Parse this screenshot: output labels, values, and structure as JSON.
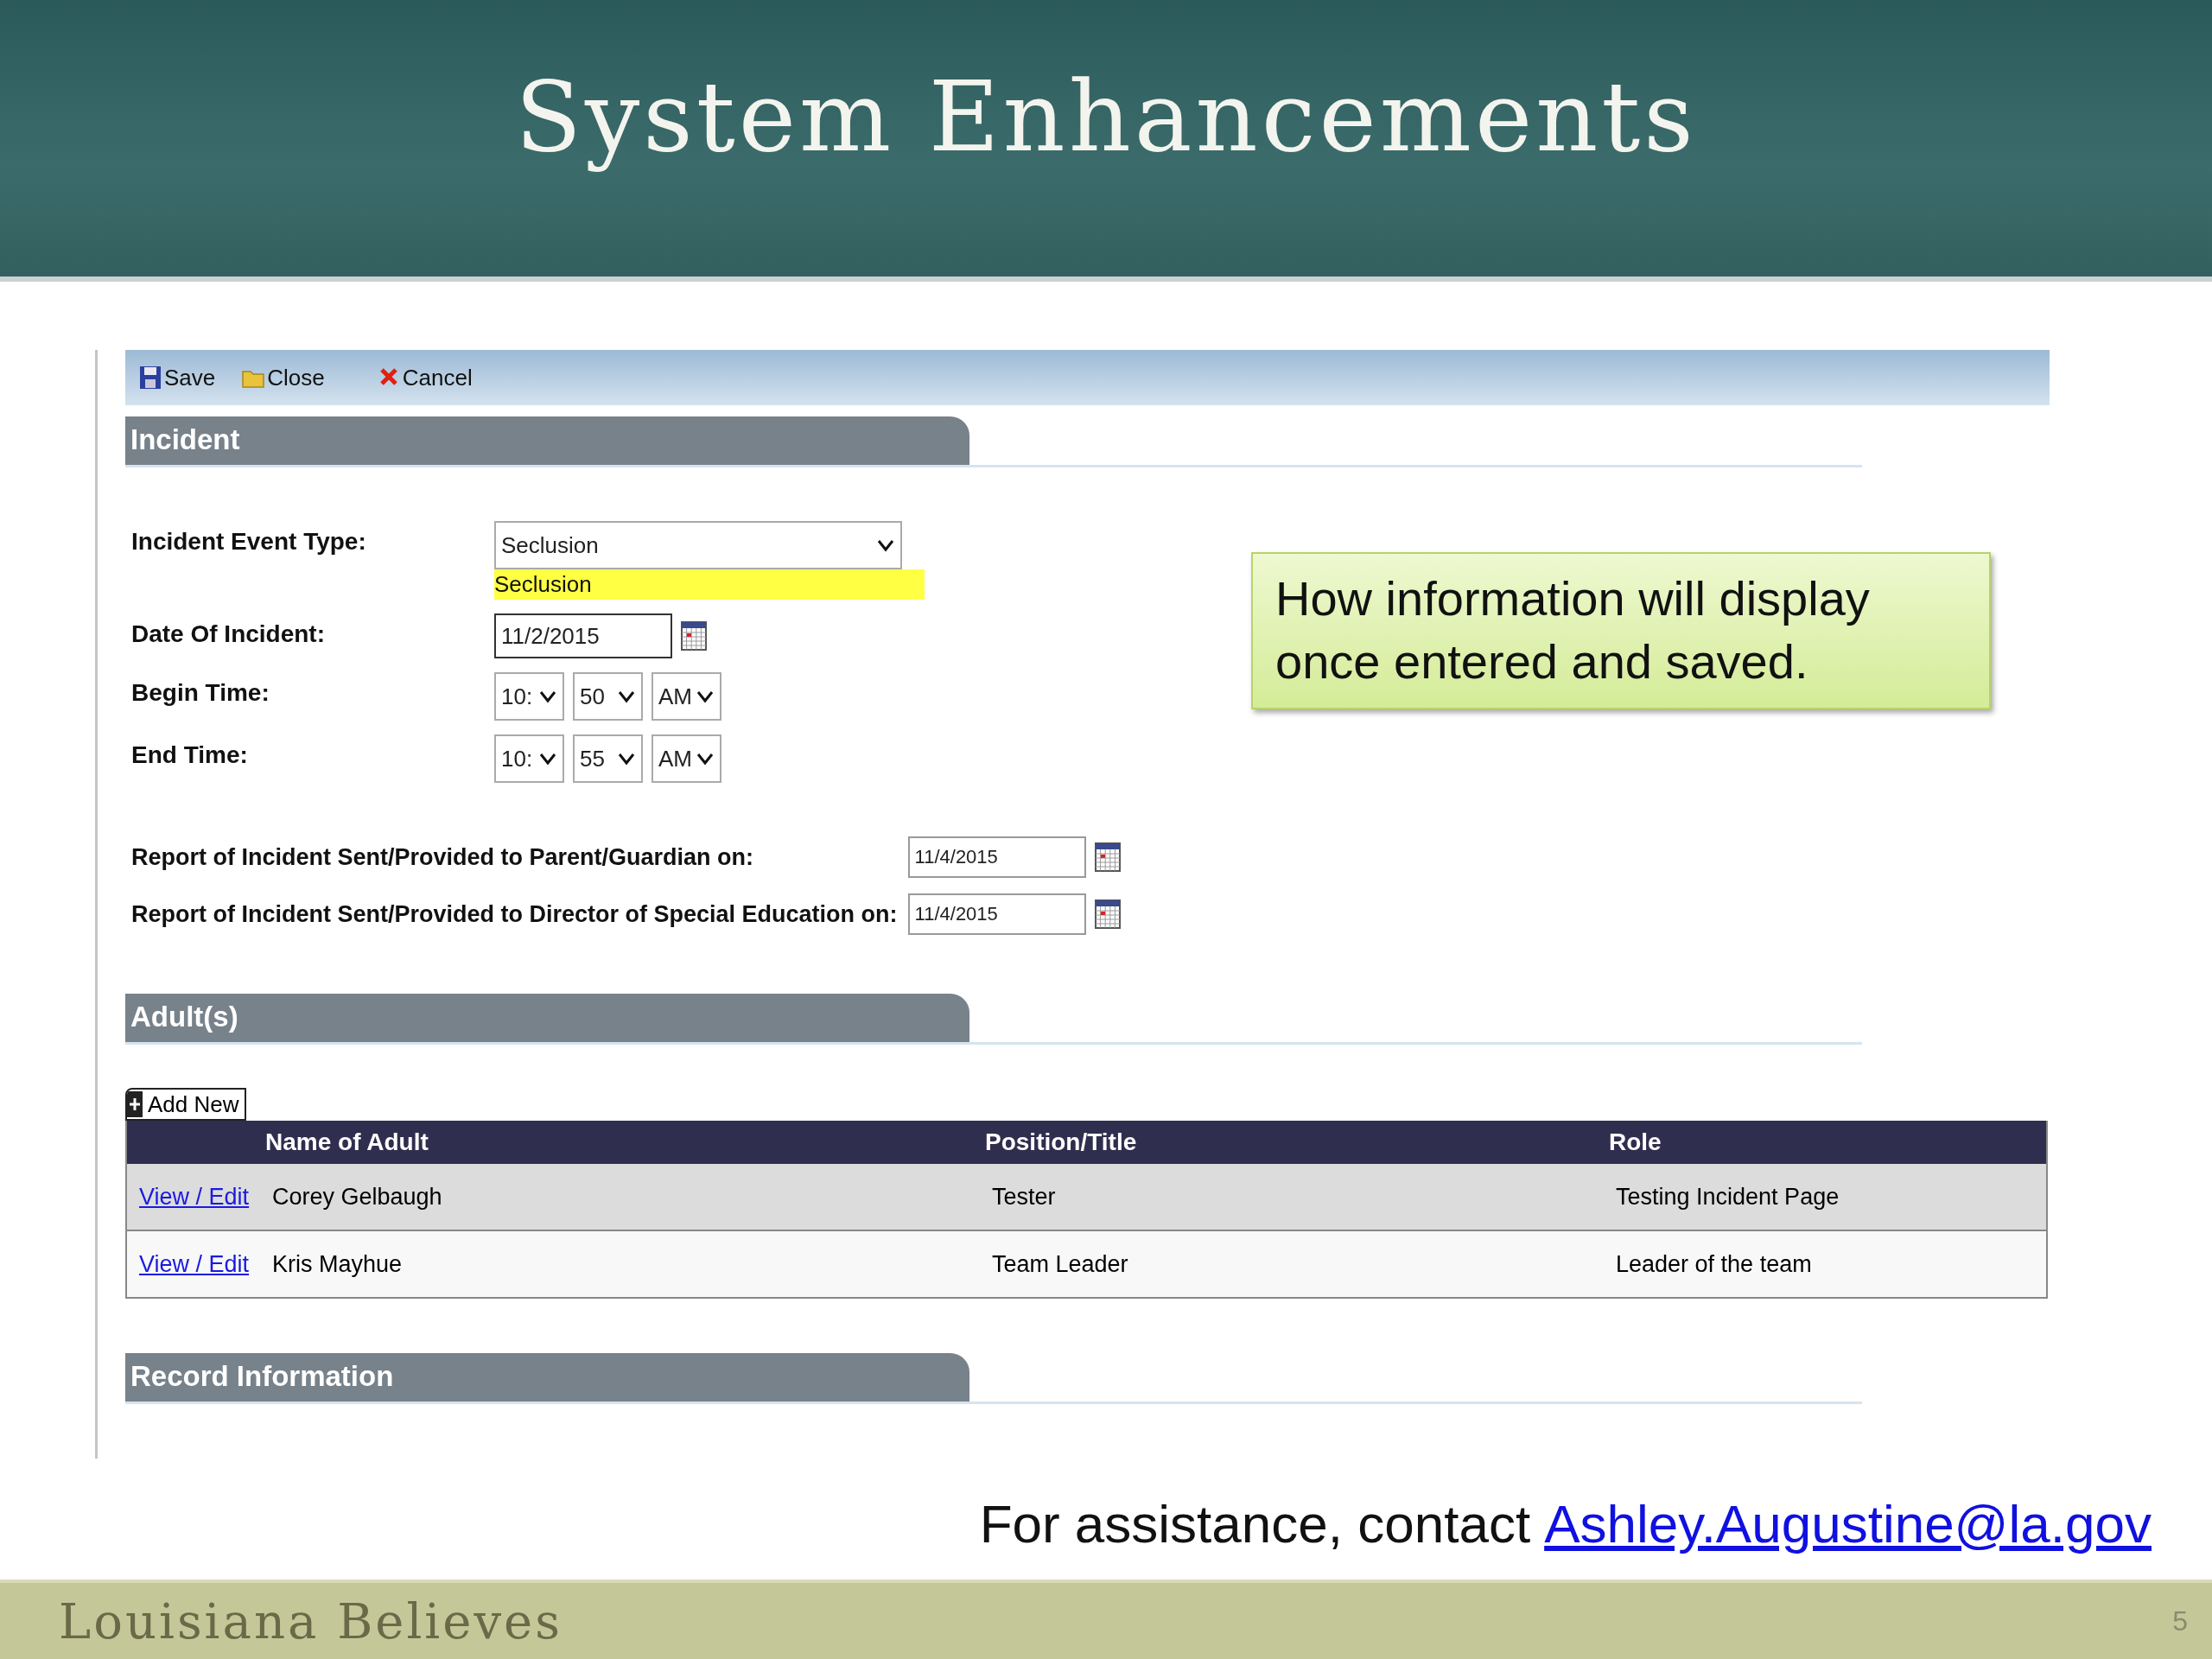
{
  "slide": {
    "title": "System Enhancements",
    "brand": "Louisiana Believes",
    "page_number": "5"
  },
  "toolbar": [
    {
      "kind": "save",
      "label": "Save"
    },
    {
      "kind": "close",
      "label": "Close"
    },
    {
      "kind": "cancel",
      "label": "Cancel"
    }
  ],
  "incident": {
    "header": "Incident",
    "fields": [
      {
        "kind": "select",
        "label": "Incident Event Type:",
        "value": "Seclusion",
        "note": "Seclusion"
      },
      {
        "kind": "date",
        "label": "Date Of Incident:",
        "value": "11/2/2015"
      },
      {
        "kind": "time",
        "label": "Begin Time:",
        "hour": "10:",
        "minute": "50",
        "period": "AM"
      },
      {
        "kind": "time",
        "label": "End Time:",
        "hour": "10:",
        "minute": "55",
        "period": "AM"
      }
    ],
    "reports": [
      {
        "label": "Report of Incident Sent/Provided to Parent/Guardian on:",
        "value": "11/4/2015"
      },
      {
        "label": "Report of Incident Sent/Provided to Director of Special Education on:",
        "value": "11/4/2015"
      }
    ]
  },
  "callout": {
    "text": "How information will display once entered and saved."
  },
  "adults": {
    "header": "Adult(s)",
    "add_button": "Add New",
    "columns": [
      "Name of Adult",
      "Position/Title",
      "Role"
    ],
    "rows": [
      {
        "link": "View / Edit",
        "name": "Corey Gelbaugh",
        "position": "Tester",
        "role": "Testing Incident Page"
      },
      {
        "link": "View / Edit",
        "name": "Kris Mayhue",
        "position": "Team Leader",
        "role": "Leader of the team"
      }
    ]
  },
  "record_information": {
    "header": "Record Information"
  },
  "contact": {
    "text": "For assistance, contact",
    "email": "Ashley.Augustine@la.gov"
  }
}
